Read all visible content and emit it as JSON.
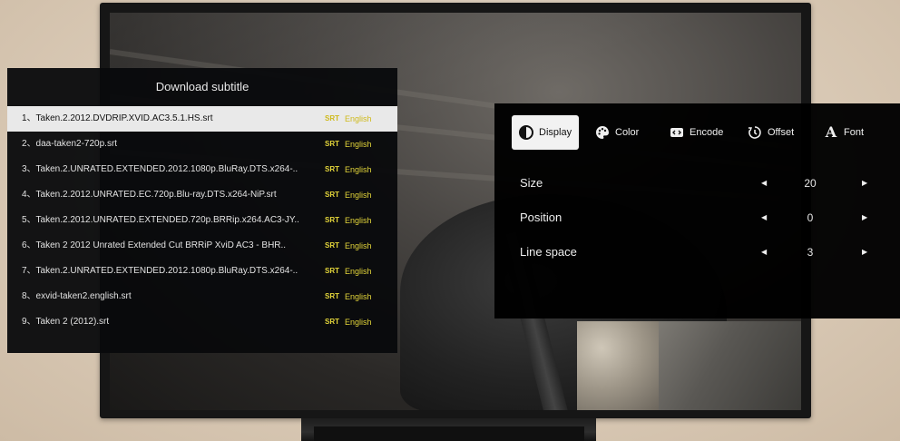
{
  "subtitle_panel": {
    "title": "Download subtitle",
    "items": [
      {
        "name": "1、Taken.2.2012.DVDRIP.XVID.AC3.5.1.HS.srt",
        "format": "SRT",
        "language": "English",
        "selected": true
      },
      {
        "name": "2、daa-taken2-720p.srt",
        "format": "SRT",
        "language": "English",
        "selected": false
      },
      {
        "name": "3、Taken.2.UNRATED.EXTENDED.2012.1080p.BluRay.DTS.x264-..",
        "format": "SRT",
        "language": "English",
        "selected": false
      },
      {
        "name": "4、Taken.2.2012.UNRATED.EC.720p.Blu-ray.DTS.x264-NiP.srt",
        "format": "SRT",
        "language": "English",
        "selected": false
      },
      {
        "name": "5、Taken.2.2012.UNRATED.EXTENDED.720p.BRRip.x264.AC3-JY..",
        "format": "SRT",
        "language": "English",
        "selected": false
      },
      {
        "name": "6、Taken 2 2012 Unrated Extended Cut BRRiP XviD AC3 - BHR..",
        "format": "SRT",
        "language": "English",
        "selected": false
      },
      {
        "name": "7、Taken.2.UNRATED.EXTENDED.2012.1080p.BluRay.DTS.x264-..",
        "format": "SRT",
        "language": "English",
        "selected": false
      },
      {
        "name": "8、exvid-taken2.english.srt",
        "format": "SRT",
        "language": "English",
        "selected": false
      },
      {
        "name": "9、Taken 2 (2012).srt",
        "format": "SRT",
        "language": "English",
        "selected": false
      }
    ]
  },
  "settings_panel": {
    "tabs": [
      {
        "label": "Display",
        "icon": "display-contrast-icon",
        "active": true
      },
      {
        "label": "Color",
        "icon": "palette-icon",
        "active": false
      },
      {
        "label": "Encode",
        "icon": "code-icon",
        "active": false
      },
      {
        "label": "Offset",
        "icon": "timer-icon",
        "active": false
      },
      {
        "label": "Font",
        "icon": "font-letter-icon",
        "active": false
      }
    ],
    "rows": [
      {
        "label": "Size",
        "value": "20"
      },
      {
        "label": "Position",
        "value": "0"
      },
      {
        "label": "Line space",
        "value": "3"
      }
    ]
  },
  "colors": {
    "format_accent": "#e4d63a",
    "selected_row_bg": "#e9e9e9",
    "panel_bg": "#08090c"
  }
}
